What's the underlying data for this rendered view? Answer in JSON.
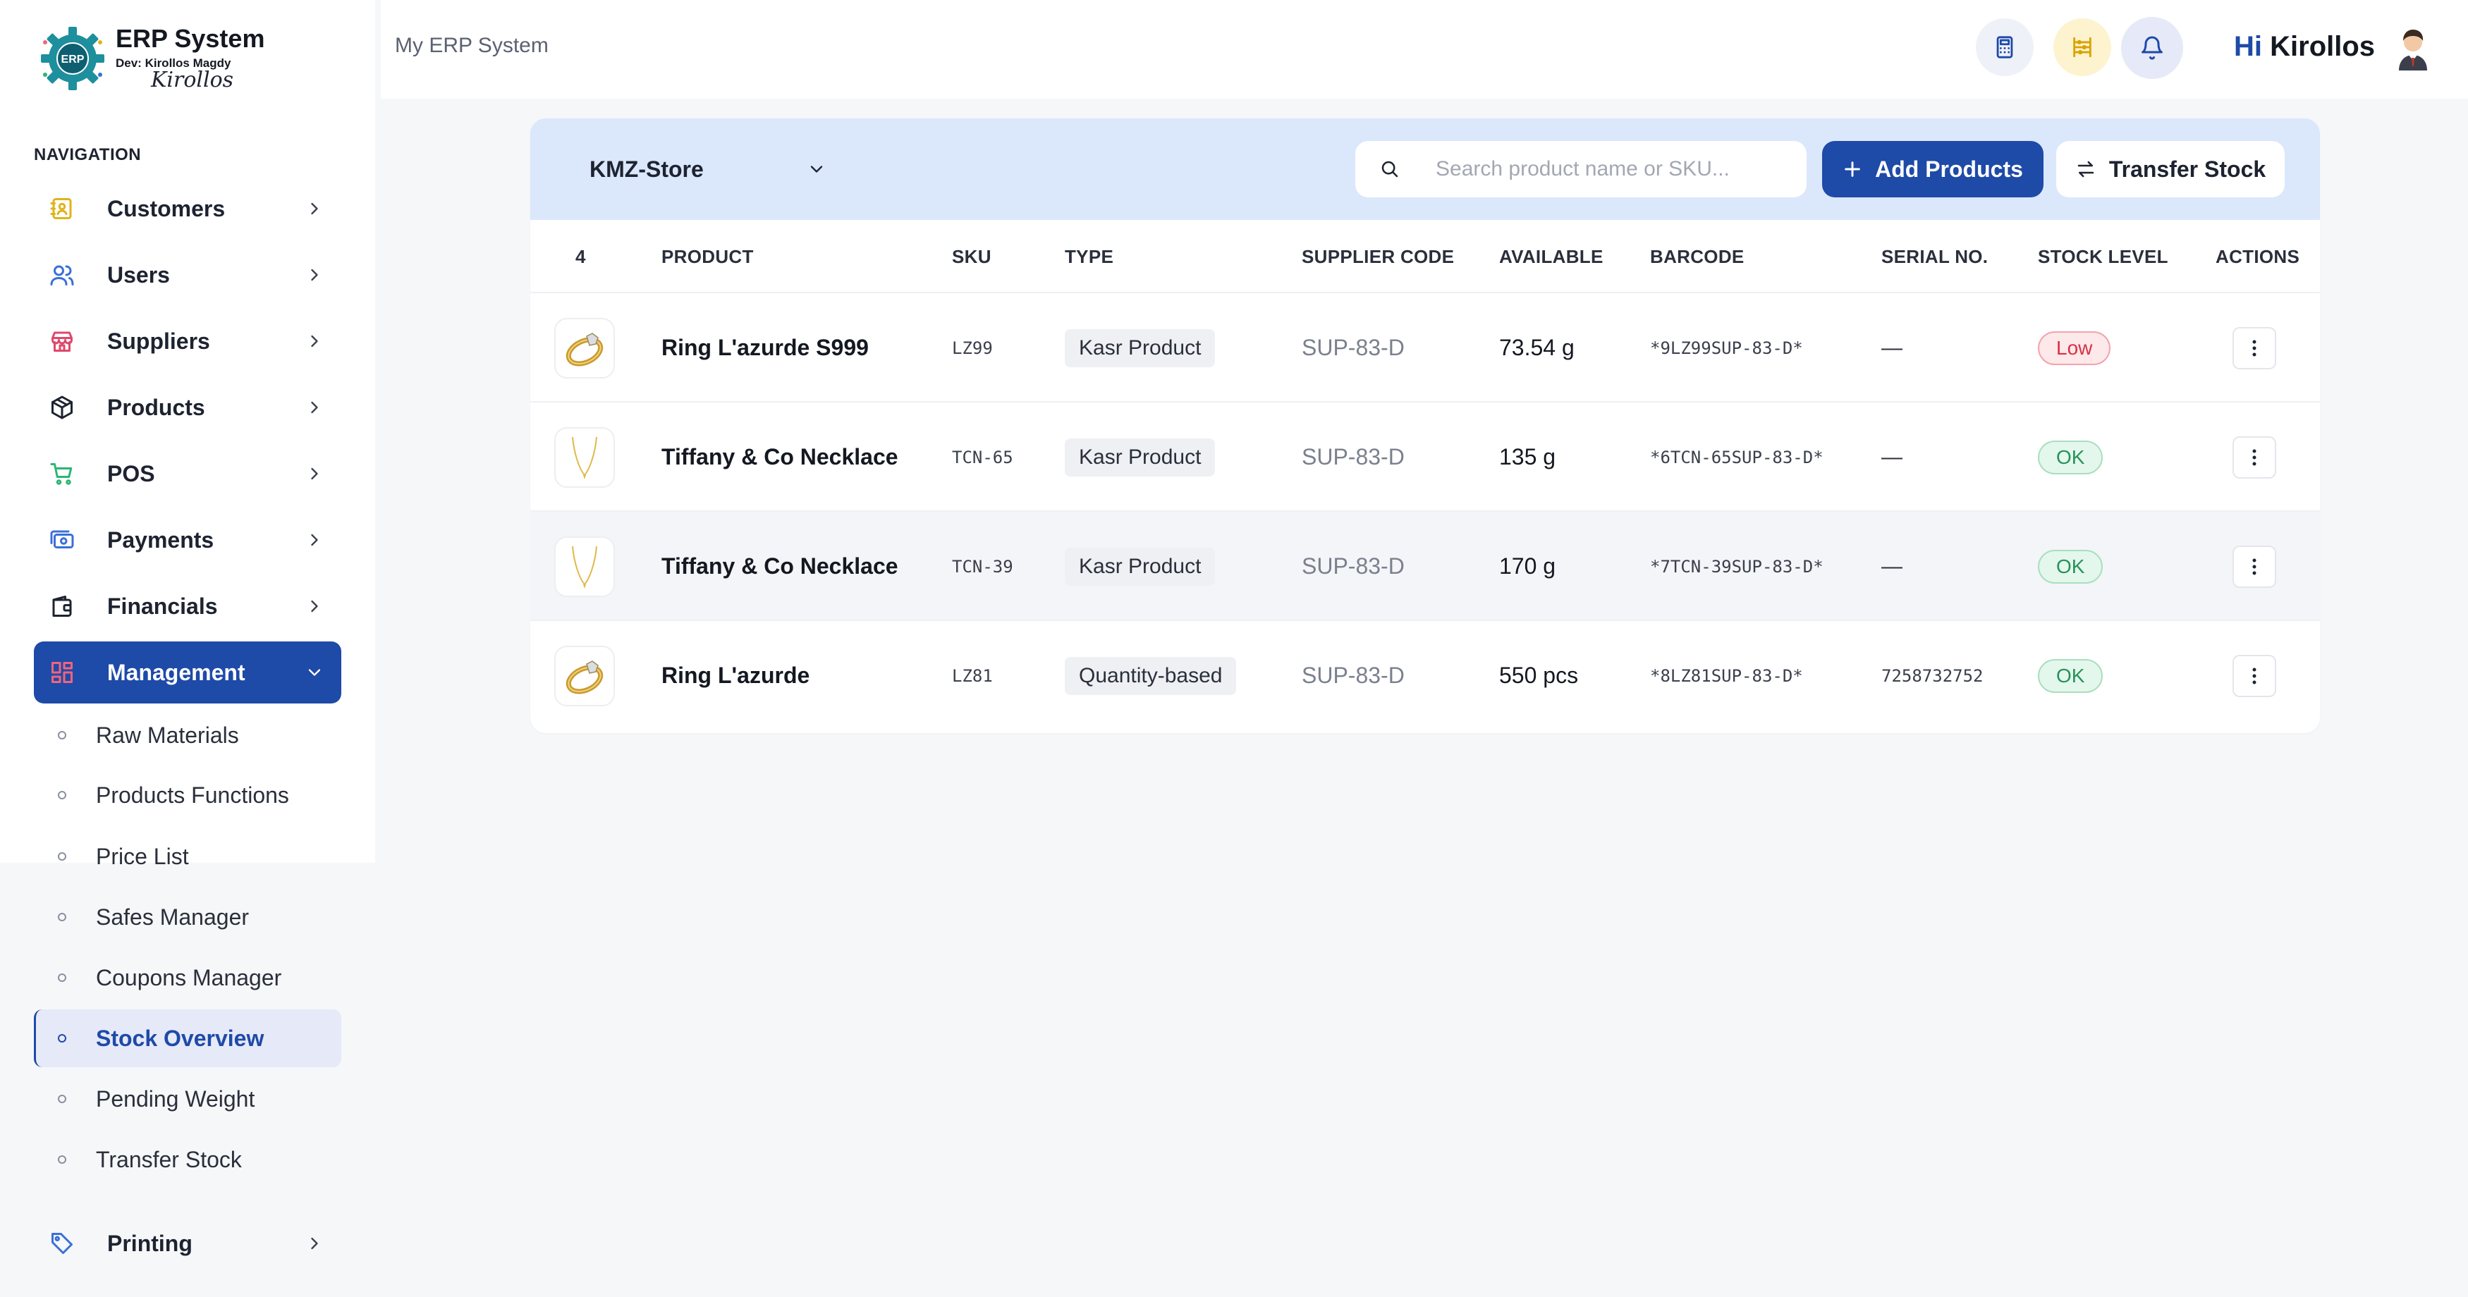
{
  "brand": {
    "title": "ERP System",
    "dev": "Dev: Kirollos Magdy",
    "signature": "Kirollos",
    "logo_text": "ERP"
  },
  "nav": {
    "heading": "NAVIGATION",
    "items": [
      {
        "label": "Customers",
        "icon": "contact-book-icon",
        "color": "#e0b31a"
      },
      {
        "label": "Users",
        "icon": "users-icon",
        "color": "#3b6fd8"
      },
      {
        "label": "Suppliers",
        "icon": "store-icon",
        "color": "#e0476a"
      },
      {
        "label": "Products",
        "icon": "box-icon",
        "color": "#1d2330"
      },
      {
        "label": "POS",
        "icon": "cart-icon",
        "color": "#2bb673"
      },
      {
        "label": "Payments",
        "icon": "payment-icon",
        "color": "#3b6fd8"
      },
      {
        "label": "Financials",
        "icon": "wallet-icon",
        "color": "#1d2330"
      },
      {
        "label": "Management",
        "icon": "grid-icon",
        "color": "#f0647c"
      },
      {
        "label": "Printing",
        "icon": "tag-icon",
        "color": "#3b6fd8"
      }
    ],
    "sub_items": [
      "Raw Materials",
      "Products Functions",
      "Price List",
      "Safes Manager",
      "Coupons Manager",
      "Stock Overview",
      "Pending Weight",
      "Transfer Stock"
    ]
  },
  "header": {
    "breadcrumb": "My ERP System",
    "greeting_hi": "Hi",
    "user_name": "Kirollos",
    "buttons": [
      "calculator-icon",
      "abacus-icon",
      "bell-icon"
    ]
  },
  "toolbar": {
    "store": "KMZ-Store",
    "search_placeholder": "Search product name or SKU...",
    "add_label": "Add Products",
    "transfer_label": "Transfer Stock"
  },
  "table": {
    "count": "4",
    "columns": [
      "PRODUCT",
      "SKU",
      "TYPE",
      "SUPPLIER CODE",
      "AVAILABLE",
      "BARCODE",
      "SERIAL NO.",
      "STOCK LEVEL",
      "ACTIONS"
    ],
    "rows": [
      {
        "thumb": "ring",
        "product": "Ring L'azurde S999",
        "sku": "LZ99",
        "type": "Kasr Product",
        "supplier": "SUP-83-D",
        "available": "73.54 g",
        "barcode": "*9LZ99SUP-83-D*",
        "serial": "—",
        "stock": "Low",
        "stock_kind": "low"
      },
      {
        "thumb": "necklace",
        "product": "Tiffany & Co Necklace",
        "sku": "TCN-65",
        "type": "Kasr Product",
        "supplier": "SUP-83-D",
        "available": "135 g",
        "barcode": "*6TCN-65SUP-83-D*",
        "serial": "—",
        "stock": "OK",
        "stock_kind": "ok"
      },
      {
        "thumb": "necklace",
        "product": "Tiffany & Co Necklace",
        "sku": "TCN-39",
        "type": "Kasr Product",
        "supplier": "SUP-83-D",
        "available": "170 g",
        "barcode": "*7TCN-39SUP-83-D*",
        "serial": "—",
        "stock": "OK",
        "stock_kind": "ok"
      },
      {
        "thumb": "ring",
        "product": "Ring L'azurde",
        "sku": "LZ81",
        "type": "Quantity-based",
        "supplier": "SUP-83-D",
        "available": "550 pcs",
        "barcode": "*8LZ81SUP-83-D*",
        "serial": "7258732752",
        "stock": "OK",
        "stock_kind": "ok"
      }
    ]
  },
  "colors": {
    "accent": "#1e4aa8",
    "toolbar_bg": "#dbe7fb",
    "low": "#d93045",
    "ok": "#27925a"
  }
}
